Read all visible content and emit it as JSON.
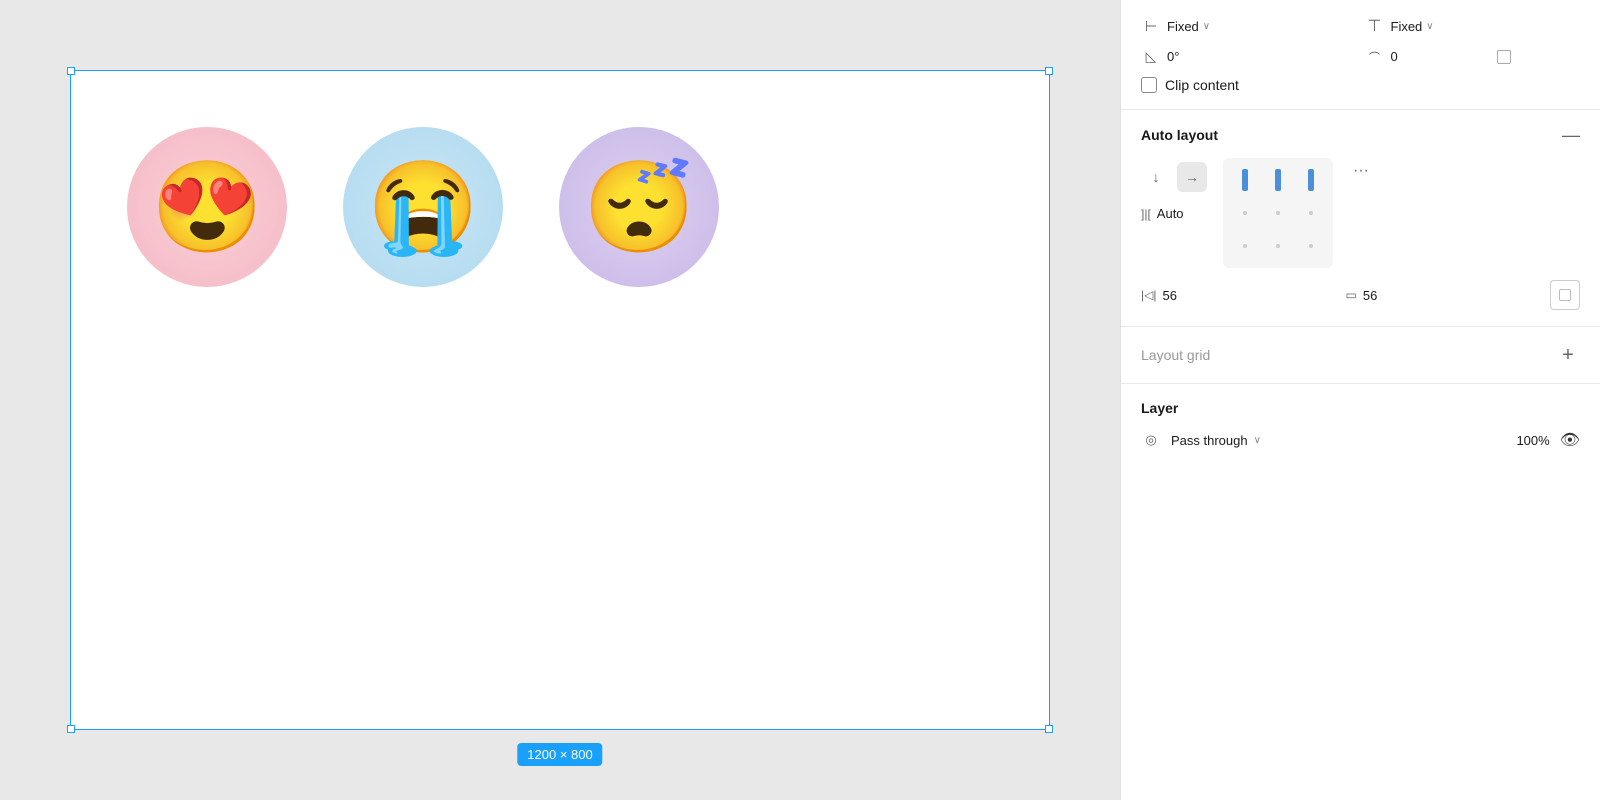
{
  "canvas": {
    "frame_size_label": "1200 × 800",
    "emojis": [
      {
        "id": "heart-eyes",
        "emoji": "😍",
        "bg_class": "pink"
      },
      {
        "id": "crying",
        "emoji": "😭",
        "bg_class": "blue"
      },
      {
        "id": "sleeping",
        "emoji": "😴",
        "bg_class": "purple"
      }
    ]
  },
  "panel": {
    "width_mode": "Fixed",
    "height_mode": "Fixed",
    "rotation": "0°",
    "corner_radius": "0",
    "clip_content_label": "Clip content",
    "auto_layout": {
      "section_title": "Auto layout",
      "collapse_icon": "—",
      "direction_down": "↓",
      "direction_right": "→",
      "spacing_h": "56",
      "spacing_v": "56",
      "wrap_mode": "Auto",
      "more_icon": "···"
    },
    "layout_grid": {
      "label": "Layout grid",
      "add_icon": "+"
    },
    "layer": {
      "section_title": "Layer",
      "mode": "Pass through",
      "opacity": "100%",
      "visibility": "visible"
    }
  }
}
